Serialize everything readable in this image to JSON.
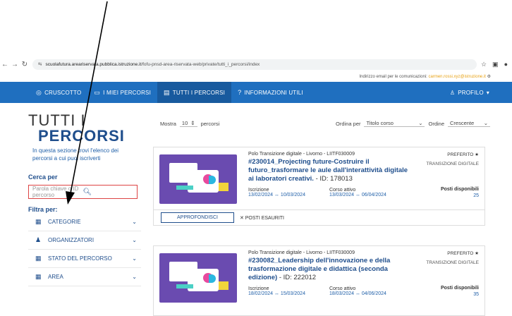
{
  "browser": {
    "url_host": "scuolafutura.areariservata.pubblica.istruzione.it",
    "url_path": "/fofu-pnsd-area-riservata-web/private/tutti_i_percorsi/index"
  },
  "email_bar": {
    "label": "Indirizzo email per le comunicazioni:",
    "email": "carmen.rossi.xyz@istruzione.it"
  },
  "nav": {
    "items": [
      {
        "icon": "◎",
        "label": "CRUSCOTTO"
      },
      {
        "icon": "▭",
        "label": "I MIEI PERCORSI"
      },
      {
        "icon": "▤",
        "label": "TUTTI I PERCORSI"
      },
      {
        "icon": "?",
        "label": "INFORMAZIONI UTILI"
      }
    ],
    "profile": "PROFILO"
  },
  "sidebar": {
    "title1": "TUTTI I",
    "title2": "PERCORSI",
    "intro": "In questa sezione trovi l'elenco dei percorsi a cui puoi iscriverti",
    "search_heading": "Cerca per",
    "search_placeholder": "Parola chiave o ID percorso",
    "filter_heading": "Filtra per:",
    "filters": [
      {
        "icon": "▦",
        "label": "CATEGORIE"
      },
      {
        "icon": "♟",
        "label": "ORGANIZZATORI"
      },
      {
        "icon": "▦",
        "label": "STATO DEL PERCORSO"
      },
      {
        "icon": "▦",
        "label": "AREA"
      }
    ]
  },
  "controls": {
    "show_label": "Mostra",
    "show_value": "10",
    "show_suffix": "percorsi",
    "order_by_label": "Ordina per",
    "order_by_value": "Titolo corso",
    "order_label": "Ordine",
    "order_value": "Crescente"
  },
  "courses": [
    {
      "ente": "Polo Transizione digitale - Livorno - LIITF030009",
      "title": "#230014_Projecting future-Costruire il futuro_trasformare le aule dall'interattività digitale ai laboratori creativi.",
      "id": "- ID: 178013",
      "iscr_label": "Iscrizione",
      "iscr_val": "13/02/2024 ↔ 10/03/2024",
      "corso_label": "Corso attivo",
      "corso_val": "13/03/2024 ↔ 06/04/2024",
      "pref": "PREFERITO ★",
      "tag": "TRANSIZIONE DIGITALE",
      "posti_label": "Posti disponibili",
      "posti_val": "25",
      "btn": "APPROFONDISCI",
      "esauriti": "✕ POSTI ESAURITI"
    },
    {
      "ente": "Polo Transizione digitale - Livorno - LIITF030009",
      "title": "#230082_Leadership dell'innovazione e della trasformazione digitale e didattica (seconda edizione)",
      "id": "- ID: 222012",
      "iscr_label": "Iscrizione",
      "iscr_val": "18/02/2024 ↔ 15/03/2024",
      "corso_label": "Corso attivo",
      "corso_val": "18/03/2024 ↔ 04/06/2024",
      "pref": "PREFERITO ★",
      "tag": "TRANSIZIONE DIGITALE",
      "posti_label": "Posti disponibili",
      "posti_val": "35"
    }
  ]
}
